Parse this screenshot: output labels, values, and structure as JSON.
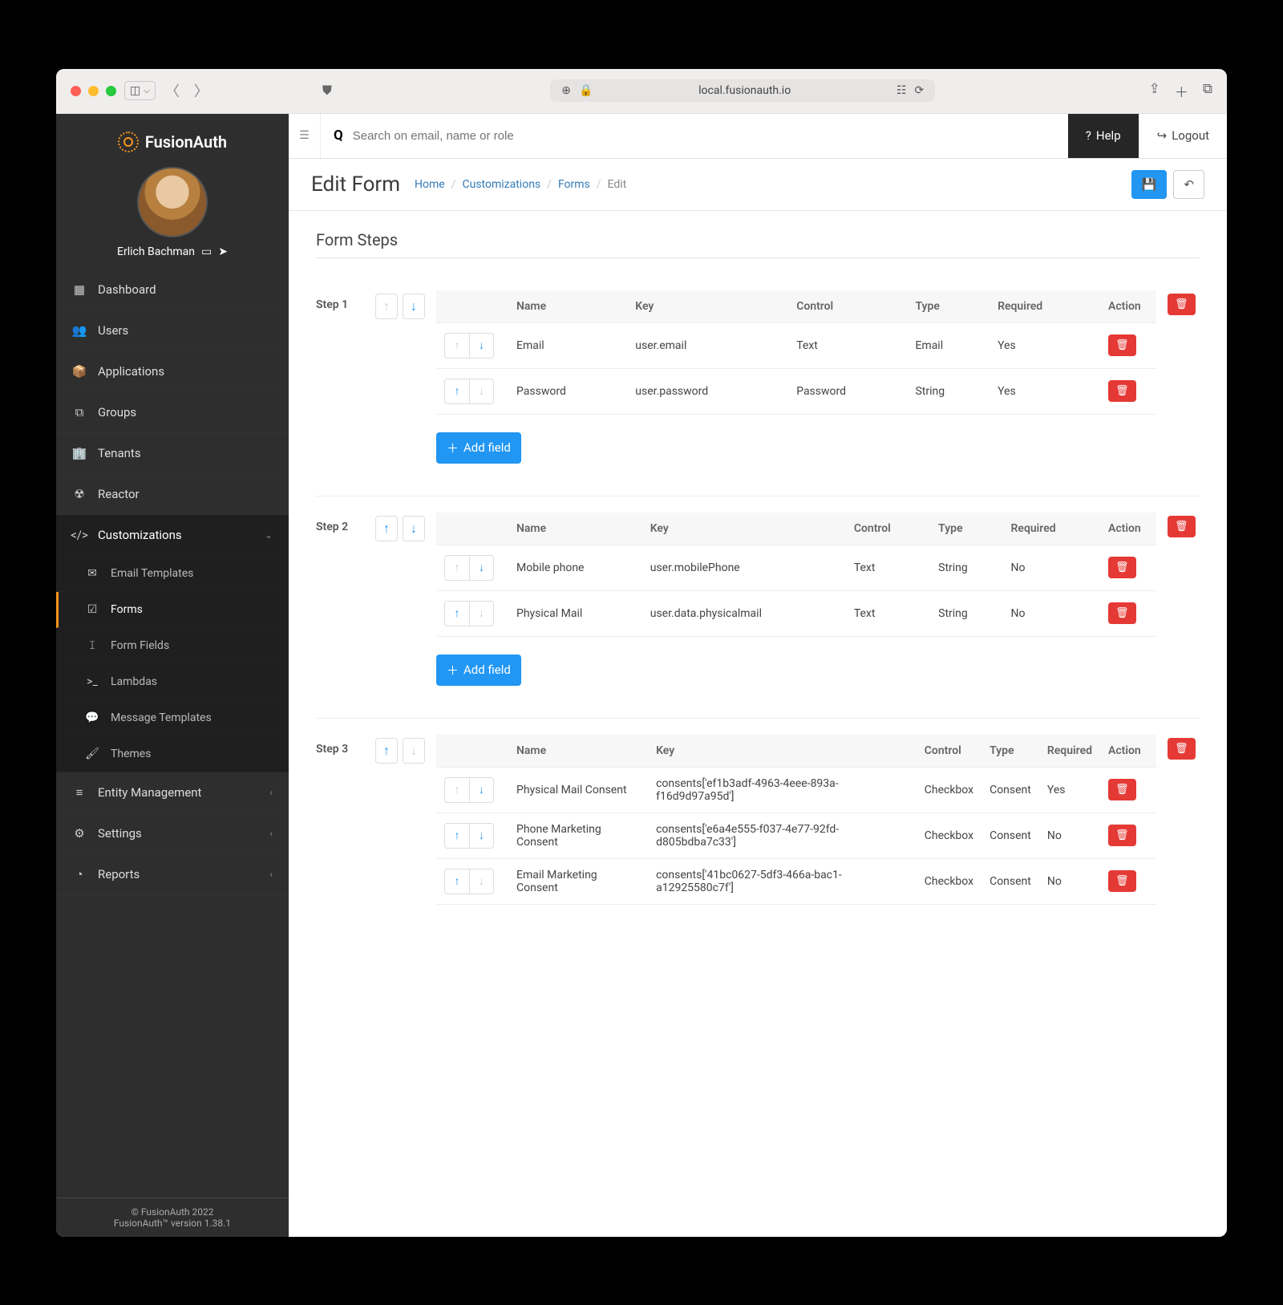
{
  "browser": {
    "url": "local.fusionauth.io"
  },
  "brand": "FusionAuth",
  "user": {
    "name": "Erlich Bachman"
  },
  "sidebar_main": [
    {
      "icon": "▦",
      "label": "Dashboard"
    },
    {
      "icon": "👥",
      "label": "Users"
    },
    {
      "icon": "📦",
      "label": "Applications"
    },
    {
      "icon": "⧉",
      "label": "Groups"
    },
    {
      "icon": "🏢",
      "label": "Tenants"
    },
    {
      "icon": "☢",
      "label": "Reactor"
    }
  ],
  "customizations": {
    "label": "Customizations",
    "items": [
      {
        "icon": "✉",
        "label": "Email Templates"
      },
      {
        "icon": "☑",
        "label": "Forms",
        "active": true
      },
      {
        "icon": "𝙸",
        "label": "Form Fields"
      },
      {
        "icon": ">_",
        "label": "Lambdas"
      },
      {
        "icon": "💬",
        "label": "Message Templates"
      },
      {
        "icon": "🖌",
        "label": "Themes"
      }
    ]
  },
  "sidebar_lower": [
    {
      "icon": "≡",
      "label": "Entity Management"
    },
    {
      "icon": "⚙",
      "label": "Settings"
    },
    {
      "icon": "◔",
      "label": "Reports"
    }
  ],
  "footer": {
    "copyright": "© FusionAuth 2022",
    "version": "FusionAuth™ version 1.38.1"
  },
  "topbar": {
    "search_placeholder": "Search on email, name or role",
    "help": "Help",
    "logout": "Logout"
  },
  "page": {
    "title": "Edit Form",
    "breadcrumb": [
      "Home",
      "Customizations",
      "Forms",
      "Edit"
    ]
  },
  "section_title": "Form Steps",
  "columns": {
    "name": "Name",
    "key": "Key",
    "control": "Control",
    "type": "Type",
    "required": "Required",
    "action": "Action"
  },
  "add_field_label": "Add field",
  "steps": [
    {
      "label": "Step 1",
      "up_disabled": true,
      "down_disabled": false,
      "fields": [
        {
          "up_disabled": true,
          "down_disabled": false,
          "name": "Email",
          "key": "user.email",
          "control": "Text",
          "type": "Email",
          "required": "Yes"
        },
        {
          "up_disabled": false,
          "down_disabled": true,
          "name": "Password",
          "key": "user.password",
          "control": "Password",
          "type": "String",
          "required": "Yes"
        }
      ]
    },
    {
      "label": "Step 2",
      "up_disabled": false,
      "down_disabled": false,
      "fields": [
        {
          "up_disabled": true,
          "down_disabled": false,
          "name": "Mobile phone",
          "key": "user.mobilePhone",
          "control": "Text",
          "type": "String",
          "required": "No"
        },
        {
          "up_disabled": false,
          "down_disabled": true,
          "name": "Physical Mail",
          "key": "user.data.physicalmail",
          "control": "Text",
          "type": "String",
          "required": "No"
        }
      ]
    },
    {
      "label": "Step 3",
      "up_disabled": false,
      "down_disabled": true,
      "fields": [
        {
          "up_disabled": true,
          "down_disabled": false,
          "name": "Physical Mail Consent",
          "key": "consents['ef1b3adf-4963-4eee-893a-f16d9d97a95d']",
          "control": "Checkbox",
          "type": "Consent",
          "required": "Yes"
        },
        {
          "up_disabled": false,
          "down_disabled": false,
          "name": "Phone Marketing Consent",
          "key": "consents['e6a4e555-f037-4e77-92fd-d805bdba7c33']",
          "control": "Checkbox",
          "type": "Consent",
          "required": "No"
        },
        {
          "up_disabled": false,
          "down_disabled": true,
          "name": "Email Marketing Consent",
          "key": "consents['41bc0627-5df3-466a-bac1-a12925580c7f']",
          "control": "Checkbox",
          "type": "Consent",
          "required": "No"
        }
      ]
    }
  ]
}
